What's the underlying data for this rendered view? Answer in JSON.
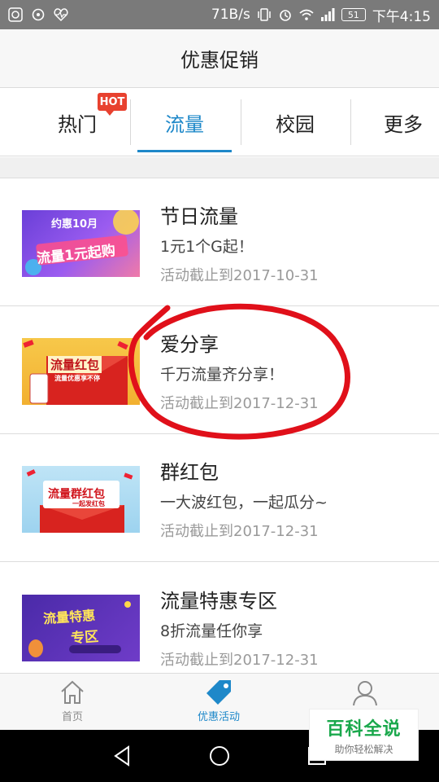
{
  "status_bar": {
    "speed": "71B/s",
    "battery": "51",
    "time": "下午4:15"
  },
  "header": {
    "title": "优惠促销"
  },
  "tabs": [
    {
      "label": "热门",
      "badge": "HOT"
    },
    {
      "label": "流量",
      "active": true
    },
    {
      "label": "校园"
    },
    {
      "label": "更多"
    }
  ],
  "promos": [
    {
      "title": "节日流量",
      "desc": "1元1个G起！",
      "date": "活动截止到2017-10-31",
      "banner_line1": "约惠10月",
      "banner_line2": "流量1元起购"
    },
    {
      "title": "爱分享",
      "desc": "千万流量齐分享！",
      "date": "活动截止到2017-12-31",
      "banner_line1": "流量红包",
      "banner_line2": "流量优惠享不停"
    },
    {
      "title": "群红包",
      "desc": "一大波红包，一起瓜分~",
      "date": "活动截止到2017-12-31",
      "banner_line1": "流量群红包",
      "banner_line2": "一起发红包"
    },
    {
      "title": "流量特惠专区",
      "desc": "8折流量任你享",
      "date": "活动截止到2017-12-31",
      "banner_line1": "流量特惠",
      "banner_line2": "专区"
    }
  ],
  "bottom_nav": [
    {
      "label": "首页",
      "icon": "home-icon"
    },
    {
      "label": "优惠活动",
      "icon": "tag-icon",
      "active": true
    },
    {
      "label": "",
      "icon": "user-icon"
    }
  ],
  "watermark": {
    "main": "百科全说",
    "sub": "助你轻松解决"
  },
  "colors": {
    "accent": "#1e88c9",
    "hot": "#e8412f",
    "annotation": "#e0101a"
  }
}
